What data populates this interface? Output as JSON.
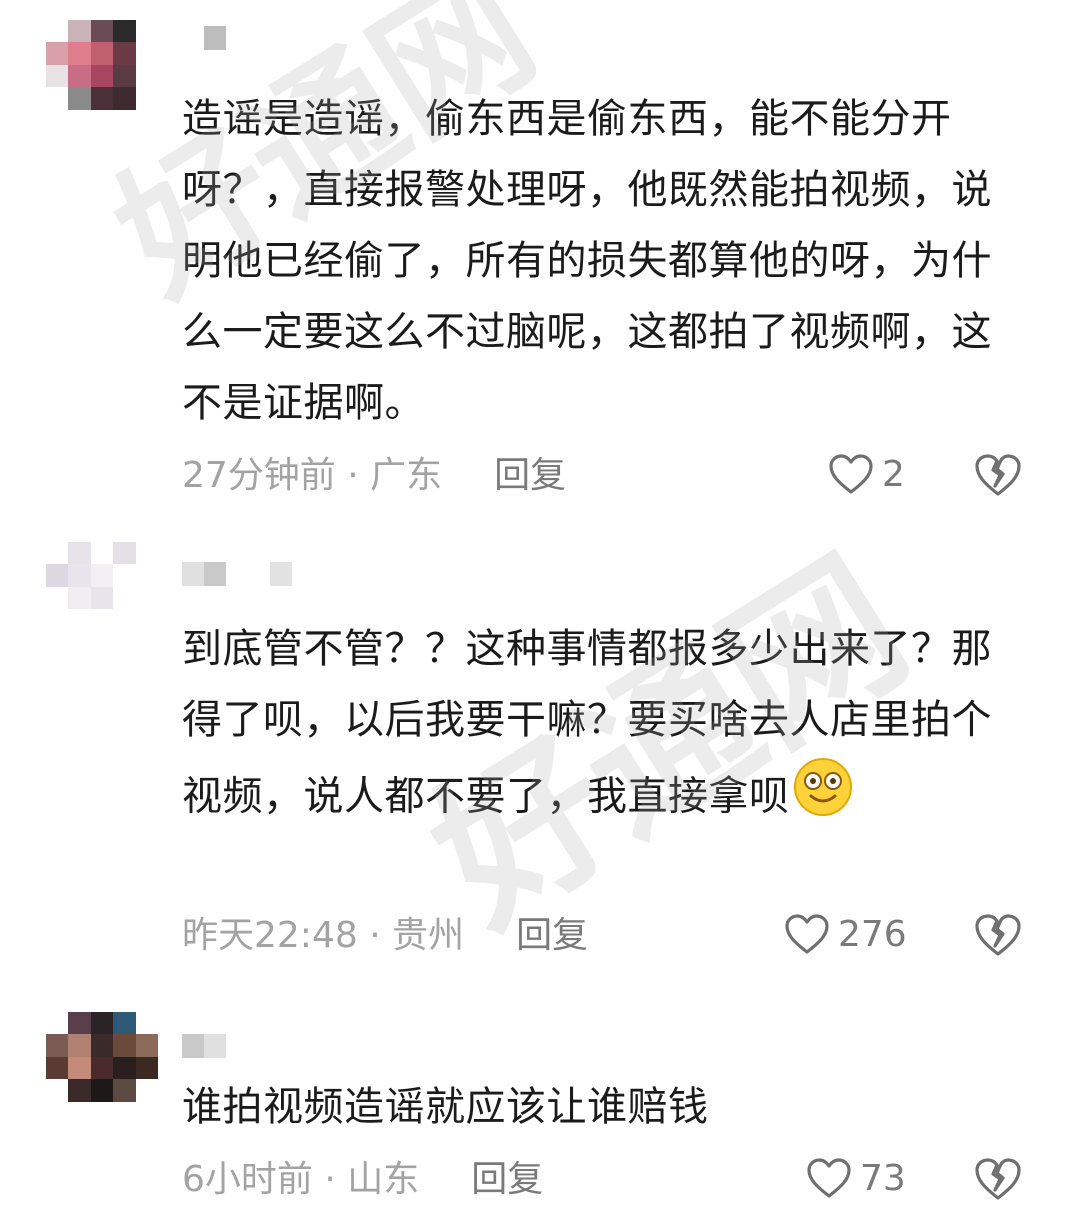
{
  "watermark": "好通网",
  "colors": {
    "text": "#1b1b1b",
    "meta": "#a3a3a3",
    "action": "#7a7a7a",
    "background": "#ffffff"
  },
  "comments": [
    {
      "avatar_colors": [
        "#ffffff",
        "#c9b3b8",
        "#6b4c56",
        "#2a2a2a",
        "#ffffff",
        "#d9a0aa",
        "#e07d8d",
        "#c0606f",
        "#6b3a44",
        "#ffffff",
        "#e8e2e4",
        "#c86d85",
        "#a84662",
        "#5a3b41",
        "#ffffff",
        "#ffffff",
        "#8a8a8a",
        "#4a3038",
        "#3d2b30",
        "#ffffff",
        "#ffffff",
        "#ffffff",
        "#ffffff",
        "#ffffff",
        "#ffffff"
      ],
      "name_blocks": [
        "#ffffff",
        "#bdbdbd"
      ],
      "text": "造谣是造谣，偷东西是偷东西，能不能分开呀？，直接报警处理呀，他既然能拍视频，说明他已经偷了，所有的损失都算他的呀，为什么一定要这么不过脑呢，这都拍了视频啊，这不是证据啊。",
      "time": "27分钟前 · 广东",
      "reply_label": "回复",
      "likes": "2",
      "heart_icon": "heart-outline-icon",
      "dislike_icon": "broken-heart-icon"
    },
    {
      "avatar_colors": [
        "#ffffff",
        "#e6e2ea",
        "#ffffff",
        "#e4e0e8",
        "#ffffff",
        "#dcd8e2",
        "#e8e4ec",
        "#f2f0f4",
        "#ffffff",
        "#ffffff",
        "#ffffff",
        "#f0eef2",
        "#e8e4ec",
        "#ffffff",
        "#ffffff",
        "#ffffff",
        "#ffffff",
        "#ffffff",
        "#ffffff",
        "#ffffff",
        "#ffffff",
        "#ffffff",
        "#ffffff",
        "#ffffff",
        "#ffffff"
      ],
      "name_blocks": [
        "#e0e0e0",
        "#c9c9c9",
        "#ffffff",
        "#ffffff",
        "#e2e2e2"
      ],
      "text": "到底管不管？？这种事情都报多少出来了？那得了呗，以后我要干嘛？要买啥去人店里拍个视频，说人都不要了，我直接拿呗",
      "time": "昨天22:48 · 贵州",
      "reply_label": "回复",
      "likes": "276",
      "emoji": "smiling-face-emoji",
      "heart_icon": "heart-outline-icon",
      "dislike_icon": "broken-heart-icon"
    },
    {
      "avatar_colors": [
        "#ffffff",
        "#5a3f4a",
        "#2b2326",
        "#2e5a78",
        "#ffffff",
        "#7a5a52",
        "#b08070",
        "#3a2a2a",
        "#6a4a3a",
        "#8b6a5a",
        "#5a3a32",
        "#c48a78",
        "#4a2a2a",
        "#2a1f1f",
        "#3a2a22",
        "#ffffff",
        "#3a2a2a",
        "#1f1818",
        "#5a4a42",
        "#ffffff",
        "#ffffff",
        "#ffffff",
        "#ffffff",
        "#ffffff",
        "#ffffff"
      ],
      "name_blocks": [
        "#c9c9c9",
        "#e0e0e0"
      ],
      "text": "谁拍视频造谣就应该让谁赔钱",
      "time": "6小时前 · 山东",
      "reply_label": "回复",
      "likes": "73",
      "heart_icon": "heart-outline-icon",
      "dislike_icon": "broken-heart-icon"
    }
  ]
}
